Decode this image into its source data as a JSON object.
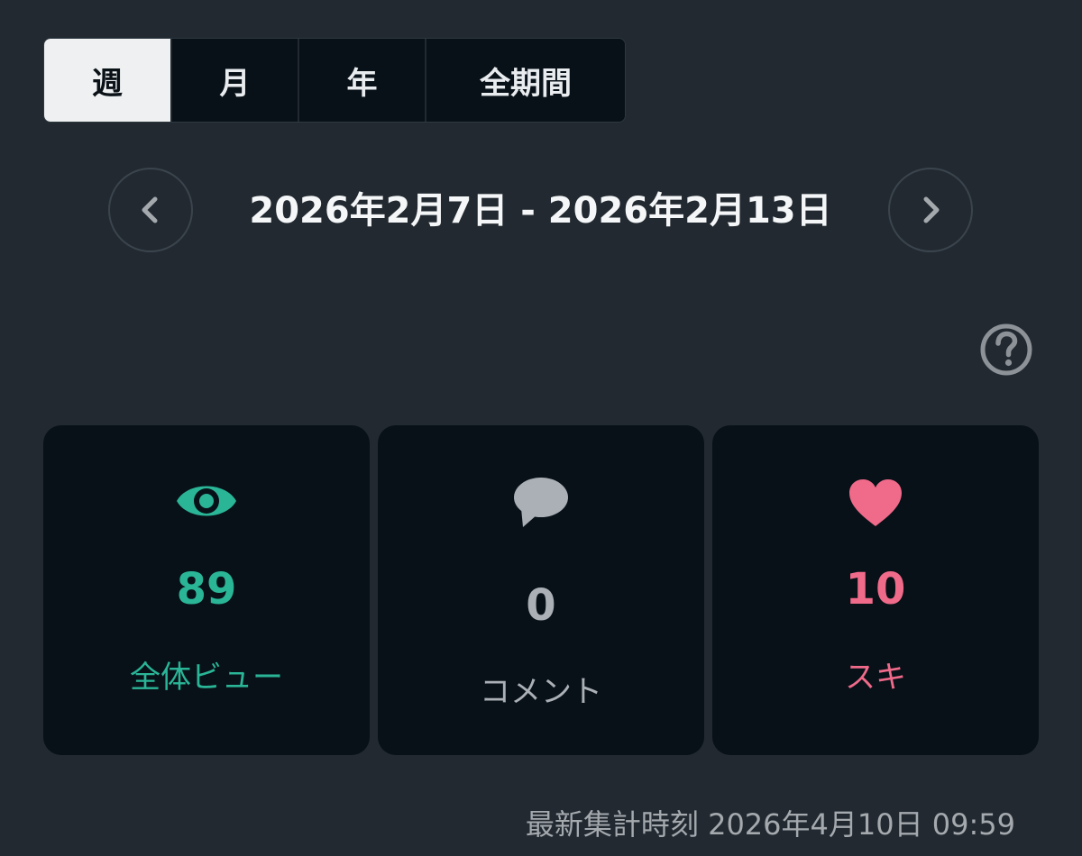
{
  "period_tabs": {
    "week": "週",
    "month": "月",
    "year": "年",
    "all": "全期間",
    "selected": "週"
  },
  "date_range": "2026年2月7日 - 2026年2月13日",
  "nav": {
    "prev_icon": "chevron-left-icon",
    "next_icon": "chevron-right-icon"
  },
  "help_icon": "question-circle-icon",
  "stats": {
    "views": {
      "value": "89",
      "label": "全体ビュー",
      "icon": "eye-icon",
      "color": "#2ab597"
    },
    "comments": {
      "value": "0",
      "label": "コメント",
      "icon": "comment-bubble-icon",
      "color": "#aab0b5"
    },
    "likes": {
      "value": "10",
      "label": "スキ",
      "icon": "heart-icon",
      "color": "#f06a8a"
    }
  },
  "footer": {
    "updated_label": "最新集計時刻",
    "updated_time": "2026年4月10日 09:59"
  }
}
